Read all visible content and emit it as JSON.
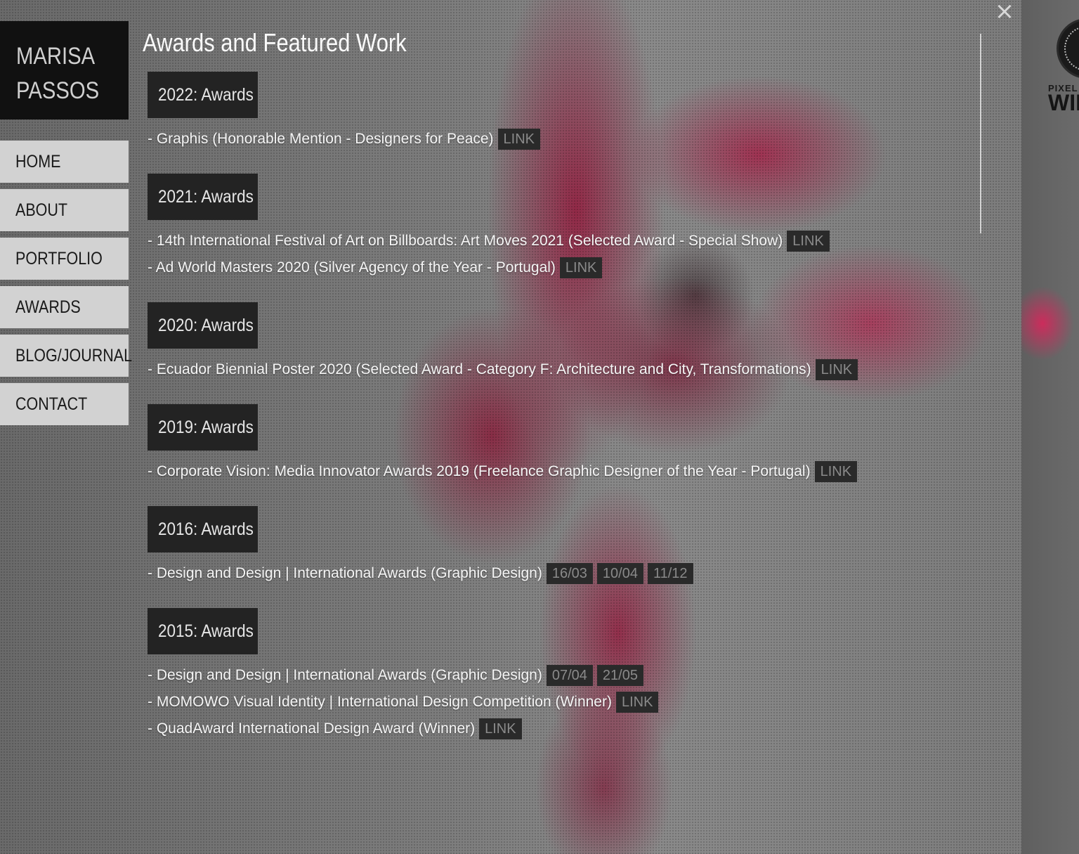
{
  "site": {
    "logo_line1": "MARISA",
    "logo_line2": "PASSOS"
  },
  "nav": {
    "items": [
      {
        "label": "HOME"
      },
      {
        "label": "ABOUT"
      },
      {
        "label": "PORTFOLIO"
      },
      {
        "label": "AWARDS"
      },
      {
        "label": "BLOG/JOURNAL"
      },
      {
        "label": "CONTACT"
      }
    ]
  },
  "page": {
    "title": "Awards and Featured Work",
    "close_icon": "×"
  },
  "badge": {
    "line1": "PIXEL",
    "line2": "WIN"
  },
  "years": [
    {
      "heading": "2022: Awards",
      "entries": [
        {
          "text": "- Graphis (Honorable Mention - Designers for Peace)",
          "tags": [
            "LINK"
          ]
        }
      ]
    },
    {
      "heading": "2021: Awards",
      "entries": [
        {
          "text": "- 14th International Festival of Art on Billboards: Art Moves 2021 (Selected Award - Special Show)",
          "tags": [
            "LINK"
          ]
        },
        {
          "text": "- Ad World Masters 2020 (Silver Agency of the Year - Portugal)",
          "tags": [
            "LINK"
          ]
        }
      ]
    },
    {
      "heading": "2020: Awards",
      "entries": [
        {
          "text": "- Ecuador Biennial Poster 2020 (Selected Award - Category F: Architecture and City, Transformations)",
          "tags": [
            "LINK"
          ]
        }
      ]
    },
    {
      "heading": "2019: Awards",
      "entries": [
        {
          "text": "- Corporate Vision: Media Innovator Awards 2019 (Freelance Graphic Designer of the Year - Portugal)",
          "tags": [
            "LINK"
          ]
        }
      ]
    },
    {
      "heading": "2016: Awards",
      "entries": [
        {
          "text": "- Design and Design | International Awards (Graphic Design)",
          "tags": [
            "16/03",
            "10/04",
            "11/12"
          ]
        }
      ]
    },
    {
      "heading": "2015: Awards",
      "entries": [
        {
          "text": "- Design and Design | International Awards (Graphic Design)",
          "tags": [
            "07/04",
            "21/05"
          ]
        },
        {
          "text": "- MOMOWO Visual Identity | International Design Competition (Winner)",
          "tags": [
            "LINK"
          ]
        },
        {
          "text": "- QuadAward International Design Award (Winner)",
          "tags": [
            "LINK"
          ]
        }
      ]
    }
  ],
  "colors": {
    "accent": "#b0103f",
    "nav_bg": "#d2d2d2",
    "heading_bg": "#232323",
    "logo_bg": "#111111"
  }
}
